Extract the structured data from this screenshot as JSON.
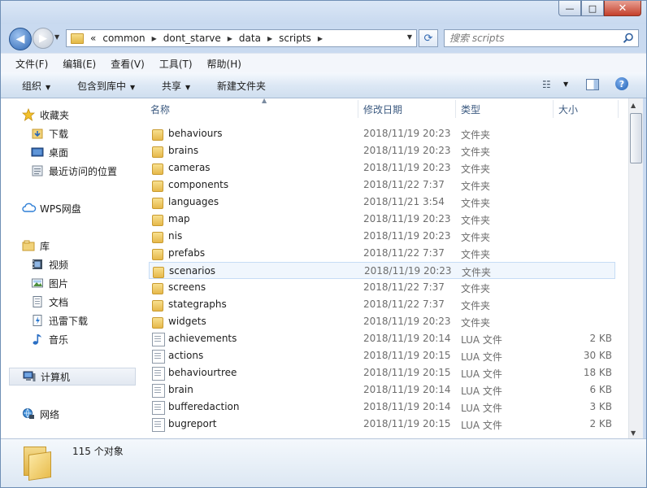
{
  "window": {
    "buttons": {
      "minimize": "—",
      "maximize": "□",
      "close": "✕"
    }
  },
  "nav": {
    "back": "◀",
    "forward": "▶",
    "address_prefix": "«",
    "breadcrumbs": [
      "common",
      "dont_starve",
      "data",
      "scripts"
    ],
    "search_placeholder": "搜索 scripts"
  },
  "menu": [
    "文件(F)",
    "编辑(E)",
    "查看(V)",
    "工具(T)",
    "帮助(H)"
  ],
  "toolbar": {
    "organize": "组织",
    "include_library": "包含到库中",
    "share": "共享",
    "new_folder": "新建文件夹"
  },
  "sidebar": [
    {
      "label": "收藏夹",
      "icon": "star-icon"
    },
    {
      "label": "下载",
      "icon": "download-folder-icon"
    },
    {
      "label": "桌面",
      "icon": "desktop-icon"
    },
    {
      "label": "最近访问的位置",
      "icon": "recent-places-icon"
    },
    {
      "label": "WPS网盘",
      "icon": "cloud-icon"
    },
    {
      "label": "库",
      "icon": "library-icon"
    },
    {
      "label": "视频",
      "icon": "video-icon"
    },
    {
      "label": "图片",
      "icon": "picture-icon"
    },
    {
      "label": "文档",
      "icon": "document-icon"
    },
    {
      "label": "迅雷下载",
      "icon": "thunder-download-icon"
    },
    {
      "label": "音乐",
      "icon": "music-icon"
    },
    {
      "label": "计算机",
      "icon": "computer-icon"
    },
    {
      "label": "网络",
      "icon": "network-icon"
    }
  ],
  "columns": {
    "name": "名称",
    "date": "修改日期",
    "type": "类型",
    "size": "大小"
  },
  "files": [
    {
      "name": "behaviours",
      "date": "2018/11/19 20:23",
      "type": "文件夹",
      "size": "",
      "kind": "folder"
    },
    {
      "name": "brains",
      "date": "2018/11/19 20:23",
      "type": "文件夹",
      "size": "",
      "kind": "folder"
    },
    {
      "name": "cameras",
      "date": "2018/11/19 20:23",
      "type": "文件夹",
      "size": "",
      "kind": "folder"
    },
    {
      "name": "components",
      "date": "2018/11/22 7:37",
      "type": "文件夹",
      "size": "",
      "kind": "folder"
    },
    {
      "name": "languages",
      "date": "2018/11/21 3:54",
      "type": "文件夹",
      "size": "",
      "kind": "folder"
    },
    {
      "name": "map",
      "date": "2018/11/19 20:23",
      "type": "文件夹",
      "size": "",
      "kind": "folder"
    },
    {
      "name": "nis",
      "date": "2018/11/19 20:23",
      "type": "文件夹",
      "size": "",
      "kind": "folder"
    },
    {
      "name": "prefabs",
      "date": "2018/11/22 7:37",
      "type": "文件夹",
      "size": "",
      "kind": "folder"
    },
    {
      "name": "scenarios",
      "date": "2018/11/19 20:23",
      "type": "文件夹",
      "size": "",
      "kind": "folder"
    },
    {
      "name": "screens",
      "date": "2018/11/22 7:37",
      "type": "文件夹",
      "size": "",
      "kind": "folder"
    },
    {
      "name": "stategraphs",
      "date": "2018/11/22 7:37",
      "type": "文件夹",
      "size": "",
      "kind": "folder"
    },
    {
      "name": "widgets",
      "date": "2018/11/19 20:23",
      "type": "文件夹",
      "size": "",
      "kind": "folder"
    },
    {
      "name": "achievements",
      "date": "2018/11/19 20:14",
      "type": "LUA 文件",
      "size": "2 KB",
      "kind": "file"
    },
    {
      "name": "actions",
      "date": "2018/11/19 20:15",
      "type": "LUA 文件",
      "size": "30 KB",
      "kind": "file"
    },
    {
      "name": "behaviourtree",
      "date": "2018/11/19 20:15",
      "type": "LUA 文件",
      "size": "18 KB",
      "kind": "file"
    },
    {
      "name": "brain",
      "date": "2018/11/19 20:14",
      "type": "LUA 文件",
      "size": "6 KB",
      "kind": "file"
    },
    {
      "name": "bufferedaction",
      "date": "2018/11/19 20:14",
      "type": "LUA 文件",
      "size": "3 KB",
      "kind": "file"
    },
    {
      "name": "bugreport",
      "date": "2018/11/19 20:15",
      "type": "LUA 文件",
      "size": "2 KB",
      "kind": "file"
    }
  ],
  "status": {
    "count": "115 个对象"
  }
}
